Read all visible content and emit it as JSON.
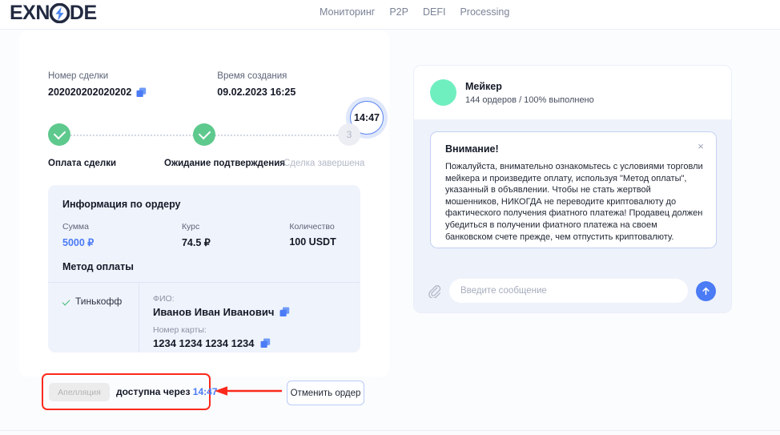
{
  "header": {
    "logo_text_before": "EXN",
    "logo_text_after": "DE",
    "logo_icon": "lightning-bolt-icon",
    "nav": [
      {
        "label": "Мониторинг",
        "name": "nav-item-monitoring"
      },
      {
        "label": "P2P",
        "name": "nav-item-p2p"
      },
      {
        "label": "DEFI",
        "name": "nav-item-defi"
      },
      {
        "label": "Processing",
        "name": "nav-item-processing"
      }
    ]
  },
  "deal": {
    "number_label": "Номер сделки",
    "number_value": "202020202020202",
    "created_label": "Время создания",
    "created_value": "09.02.2023 16:25",
    "timer": "14:47"
  },
  "stepper": {
    "steps": [
      {
        "label": "Оплата сделки",
        "state": "done",
        "marker": "check"
      },
      {
        "label": "Ожидание подтверждения",
        "state": "done",
        "marker": "check"
      },
      {
        "label": "Сделка завершена",
        "state": "pending",
        "marker": "3"
      }
    ]
  },
  "order": {
    "title": "Информация по ордеру",
    "columns": [
      {
        "label": "Сумма",
        "value": "5000 ₽",
        "accent": true
      },
      {
        "label": "Курс",
        "value": "74.5 ₽",
        "accent": false
      },
      {
        "label": "Количество",
        "value": "100 USDT",
        "accent": false
      }
    ],
    "payment_title": "Метод оплаты",
    "method_name": "Тинькофф",
    "fio_label": "ФИО:",
    "fio_value": "Иванов Иван Иванович",
    "card_label": "Номер карты:",
    "card_value": "1234 1234 1234 1234"
  },
  "actions": {
    "appeal_label": "Апелляция",
    "available_prefix": "доступна через",
    "available_time": "14:47",
    "cancel_label": "Отменить ордер"
  },
  "chat": {
    "maker_name": "Мейкер",
    "maker_stats": "144 ордеров / 100% выполнено",
    "notice_title": "Внимание!",
    "notice_close": "×",
    "notice_text": "Пожалуйста, внимательно ознакомьтесь с условиями торговли мейкера и произведите оплату, используя \"Метод оплаты\", указанный в объявлении. Чтобы не стать жертвой мошенников, НИКОГДА не переводите криптовалюту до фактического получения фиатного платежа! Продавец должен убедиться в получении фиатного платежа на своем банковском счете прежде, чем отпустить криптовалюту.",
    "input_placeholder": "Введите сообщение",
    "input_value": ""
  },
  "colors": {
    "accent_blue": "#4b7bf5",
    "success_green": "#5ec98d",
    "avatar_green": "#6fefc0",
    "annotation_red": "#fb2a1c",
    "panel_tint": "#eff3fc",
    "chat_tint": "#eef2fb"
  }
}
